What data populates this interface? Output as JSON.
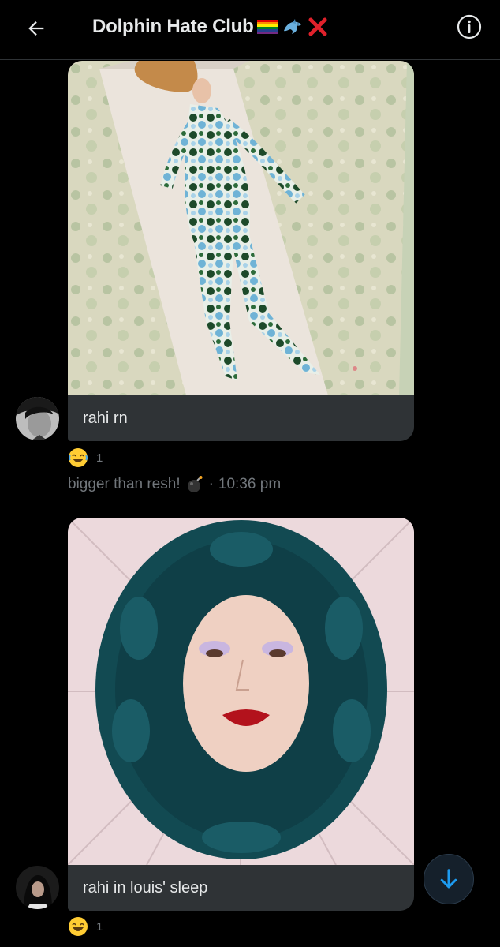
{
  "header": {
    "title": "Dolphin Hate Club",
    "title_emojis": [
      "rainbow-flag",
      "dolphin",
      "cross-mark"
    ],
    "back_icon": "arrow-left-icon",
    "info_icon": "info-icon"
  },
  "messages": [
    {
      "caption": "rahi rn",
      "image_desc": "",
      "reaction": {
        "emoji": "laughing-face",
        "count": "1"
      },
      "sender_meta": "bigger than resh!",
      "meta_emoji": "bomb",
      "separator": "·",
      "time": "10:36 pm"
    },
    {
      "caption": "rahi in louis' sleep",
      "reaction": {
        "emoji": "laughing-face",
        "count": "1"
      }
    }
  ],
  "colors": {
    "background": "#000000",
    "bubble": "#2f3336",
    "accent": "#1d9bf0",
    "muted": "#71767b"
  }
}
